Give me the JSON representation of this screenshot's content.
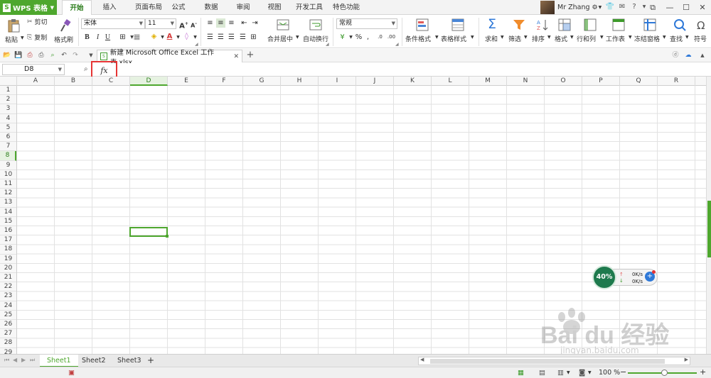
{
  "app": {
    "name": "WPS 表格",
    "logo": "S"
  },
  "menu_tabs": [
    "开始",
    "插入",
    "页面布局",
    "公式",
    "数据",
    "审阅",
    "视图",
    "开发工具",
    "特色功能"
  ],
  "active_menu_tab": "开始",
  "user": {
    "name": "Mr Zhang"
  },
  "ribbon": {
    "paste": "粘贴",
    "cut": "剪切",
    "copy": "复制",
    "format_painter": "格式刷",
    "font_name": "宋体",
    "font_size": "11",
    "bold": "B",
    "italic": "I",
    "underline": "U",
    "merge_center": "合并居中",
    "wrap_text": "自动换行",
    "number_format": "常规",
    "percent": "%",
    "conditional_format": "条件格式",
    "table_style": "表格样式",
    "sum": "求和",
    "filter": "筛选",
    "sort": "排序",
    "format": "格式",
    "rows_cols": "行和列",
    "worksheet": "工作表",
    "freeze_panes": "冻结窗格",
    "find": "查找",
    "symbol": "符号"
  },
  "document": {
    "filename": "新建 Microsoft Office Excel 工作表.xlsx"
  },
  "formula_bar": {
    "name_box": "D8",
    "fx": "fx",
    "content": ""
  },
  "grid": {
    "columns": [
      "A",
      "B",
      "C",
      "D",
      "E",
      "F",
      "G",
      "H",
      "I",
      "J",
      "K",
      "L",
      "M",
      "N",
      "O",
      "P",
      "Q",
      "R"
    ],
    "rows": [
      "1",
      "2",
      "3",
      "4",
      "5",
      "6",
      "7",
      "8",
      "9",
      "10",
      "11",
      "12",
      "13",
      "14",
      "15",
      "16",
      "17",
      "18",
      "19",
      "20",
      "21",
      "22",
      "23",
      "24",
      "25",
      "26",
      "27",
      "28",
      "29"
    ],
    "selected_column": "D",
    "selected_row": "8"
  },
  "network_widget": {
    "percent": "40%",
    "upload": "0K/s",
    "download": "0K/s"
  },
  "watermark": {
    "text": "Bai du 经验",
    "url": "jingyan.baidu.com"
  },
  "sheets": [
    "Sheet1",
    "Sheet2",
    "Sheet3"
  ],
  "active_sheet": "Sheet1",
  "status": {
    "zoom": "100 %"
  },
  "colors": {
    "accent": "#4ea72e",
    "highlight_box": "#e63434"
  }
}
